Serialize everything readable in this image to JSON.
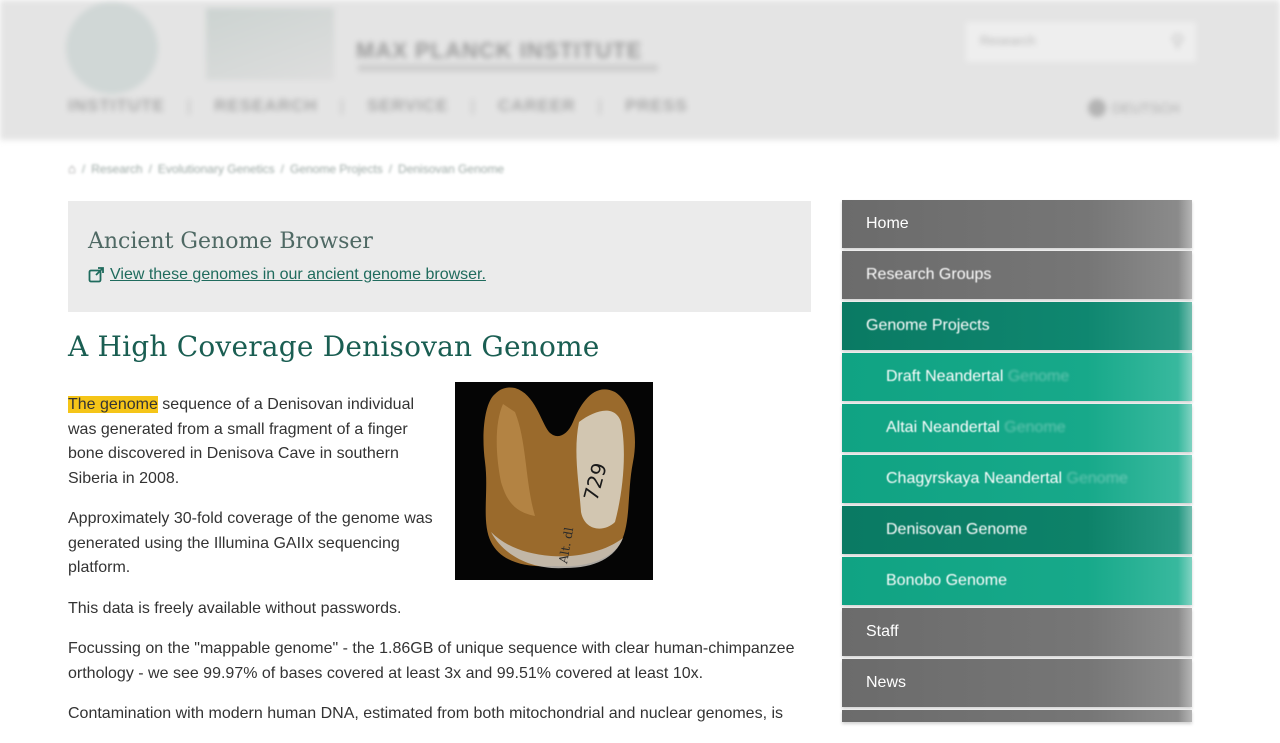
{
  "header": {
    "institute_name": "MAX PLANCK INSTITUTE",
    "search_placeholder": "Research",
    "nav": [
      "INSTITUTE",
      "RESEARCH",
      "SERVICE",
      "CAREER",
      "PRESS"
    ],
    "language": "DEUTSCH"
  },
  "breadcrumb": [
    "Research",
    "Evolutionary Genetics",
    "Genome Projects",
    "Denisovan Genome"
  ],
  "browser_box": {
    "title": "Ancient Genome Browser",
    "link": "View these genomes in our ancient genome browser."
  },
  "main": {
    "title": "A High Coverage Denisovan Genome",
    "p1_highlight": "The genome",
    "p1_rest": " sequence of a Denisovan individual was generated from a small fragment of a finger bone discovered in Denisova Cave in southern Siberia in 2008.",
    "p2": "Approximately 30-fold coverage of the genome was generated using the Illumina GAIIx sequencing platform.",
    "p3": "This data is freely available without passwords.",
    "p4": "Focussing on the \"mappable genome\" - the 1.86GB of unique sequence with  clear human-chimpanzee orthology  - we see 99.97% of bases covered at least 3x and 99.51% covered at least 10x.",
    "p5": "Contamination with modern human DNA, estimated from both mitochondrial and nuclear genomes, is"
  },
  "sidebar": {
    "home": "Home",
    "research_groups": "Research Groups",
    "genome_projects": "Genome Projects",
    "draft_neandertal": "Draft Neandertal ",
    "draft_neandertal_fade": "Genome",
    "altai_neandertal": "Altai Neandertal ",
    "altai_neandertal_fade": "Genome",
    "chagyrskaya": "Chagyrskaya Neandertal ",
    "chagyrskaya_fade": "Genome",
    "denisovan": "Denisovan Genome",
    "bonobo": "Bonobo Genome",
    "staff": "Staff",
    "news": "News"
  },
  "colors": {
    "accent_teal": "#17a98a",
    "accent_teal_dark": "#0a7a63",
    "title_green": "#1a5e52",
    "highlight": "#f5c518",
    "sidebar_grey": "#6b6b6b"
  }
}
